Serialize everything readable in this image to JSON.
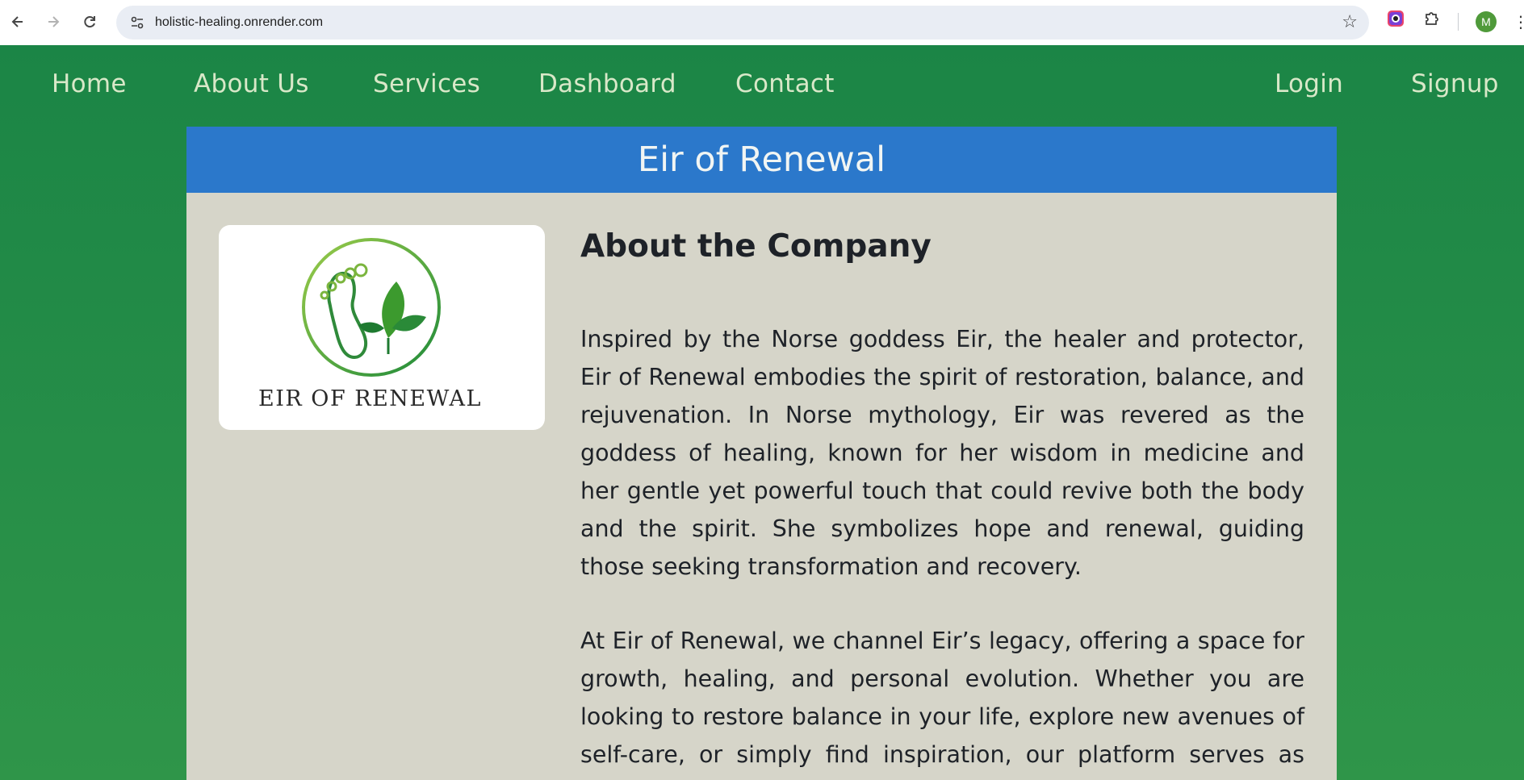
{
  "browser": {
    "url": "holistic-healing.onrender.com",
    "avatar_letter": "M"
  },
  "nav": {
    "left": [
      "Home",
      "About Us",
      "Services",
      "Dashboard",
      "Contact"
    ],
    "right": [
      "Login",
      "Signup"
    ]
  },
  "panel": {
    "title": "Eir of Renewal",
    "logo_text": "EIR OF RENEWAL",
    "heading": "About the Company",
    "paragraphs": [
      "Inspired by the Norse goddess Eir, the healer and protector, Eir of Renewal embodies the spirit of restoration, balance, and rejuvenation. In Norse mythology, Eir was revered as the goddess of healing, known for her wisdom in medicine and her gentle yet powerful touch that could revive both the body and the spirit. She symbolizes hope and renewal, guiding those seeking transformation and recovery.",
      "At Eir of Renewal, we channel Eir’s legacy, offering a space for growth, healing, and personal evolution. Whether you are looking to restore balance in your life, explore new avenues of self-care, or simply find inspiration, our platform serves as your"
    ]
  },
  "colors": {
    "page_green": "#1b8546",
    "header_blue": "#2b78cb",
    "panel_bg": "#d6d5c9",
    "nav_text": "#d8e8c8"
  },
  "icons": [
    "back-arrow-icon",
    "forward-arrow-icon",
    "reload-icon",
    "site-settings-icon",
    "star-icon",
    "extension-color-icon",
    "puzzle-icon",
    "kebab-menu-icon"
  ]
}
